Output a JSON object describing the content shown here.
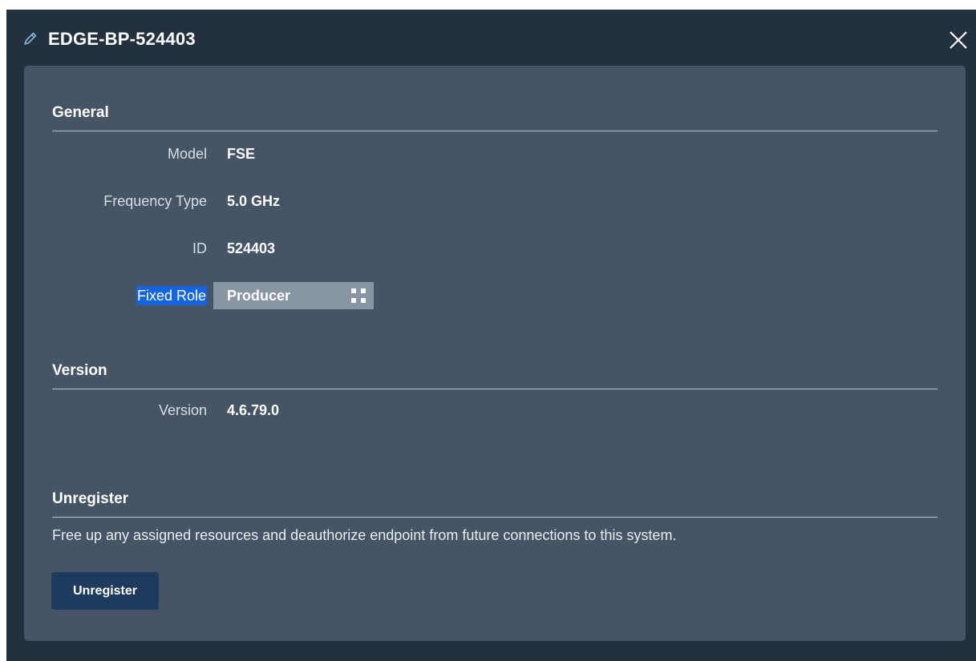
{
  "dialog": {
    "title": "EDGE-BP-524403",
    "title_icon": "pencil-icon",
    "close_icon": "close-icon"
  },
  "general": {
    "heading": "General",
    "model_label": "Model",
    "model_value": "FSE",
    "frequency_label": "Frequency Type",
    "frequency_value": "5.0 GHz",
    "id_label": "ID",
    "id_value": "524403",
    "fixed_role_label": "Fixed Role",
    "fixed_role_value": "Producer",
    "fixed_role_icon": "grid-icon"
  },
  "version": {
    "heading": "Version",
    "version_label": "Version",
    "version_value": "4.6.79.0"
  },
  "unregister": {
    "heading": "Unregister",
    "description": "Free up any assigned resources and deauthorize endpoint from future connections to this system.",
    "button_label": "Unregister"
  },
  "colors": {
    "dialog_bg": "#23303f",
    "panel_bg": "#455566",
    "select_bg": "#8895a3",
    "highlight": "#1565e0",
    "button_bg": "#1e3a5c"
  }
}
